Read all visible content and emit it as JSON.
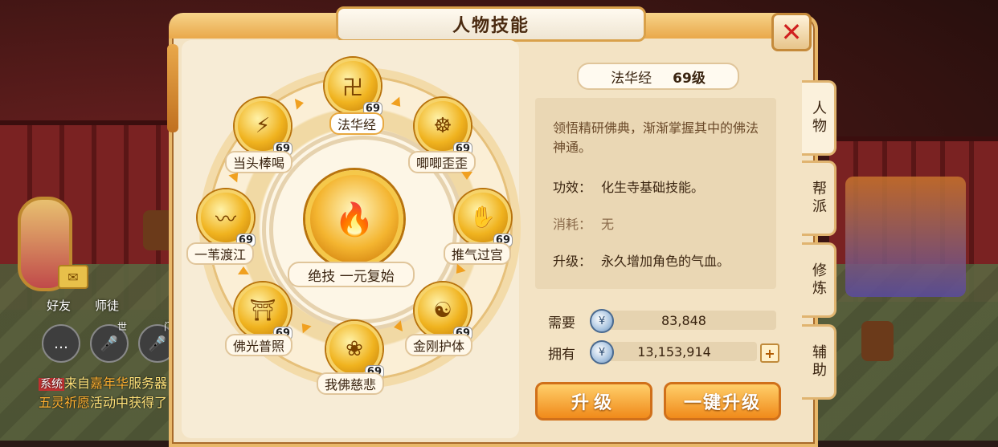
{
  "window": {
    "title": "人物技能"
  },
  "hud": {
    "friends_label": "好友",
    "master_label": "师徒",
    "icon_world": "世",
    "icon_hall": "门",
    "chat": [
      {
        "tag": "系统",
        "prefix": "来自",
        "highlight": "嘉年华",
        "rest": "服务器"
      },
      {
        "highlight": "五灵祈愿",
        "rest": "活动中获得了"
      }
    ]
  },
  "skills": [
    {
      "name": "法华经",
      "level": "69",
      "selected": true
    },
    {
      "name": "唧唧歪歪",
      "level": "69"
    },
    {
      "name": "推气过宫",
      "level": "69"
    },
    {
      "name": "金刚护体",
      "level": "69"
    },
    {
      "name": "我佛慈悲",
      "level": "69"
    },
    {
      "name": "佛光普照",
      "level": "69"
    },
    {
      "name": "一苇渡江",
      "level": "69"
    },
    {
      "name": "当头棒喝",
      "level": "69"
    }
  ],
  "ultimate": {
    "label": "绝技  一元复始"
  },
  "detail": {
    "name": "法华经",
    "level": "69级",
    "description": "领悟精研佛典，渐渐掌握其中的佛法神通。",
    "effect_key": "功效：",
    "effect_val": "化生寺基础技能。",
    "cost_key": "消耗：",
    "cost_val": "无",
    "upgrade_key": "升级：",
    "upgrade_val": "永久增加角色的气血。"
  },
  "cost": {
    "need_label": "需要",
    "need_value": "83,848",
    "have_label": "拥有",
    "have_value": "13,153,914"
  },
  "buttons": {
    "upgrade": "升级",
    "one_key_upgrade": "一键升级"
  },
  "tabs": [
    "人物",
    "帮派",
    "修炼",
    "辅助"
  ],
  "colors": {
    "accent": "#f08a1a",
    "panel": "#f3e3c4",
    "close": "#d01f1f"
  }
}
